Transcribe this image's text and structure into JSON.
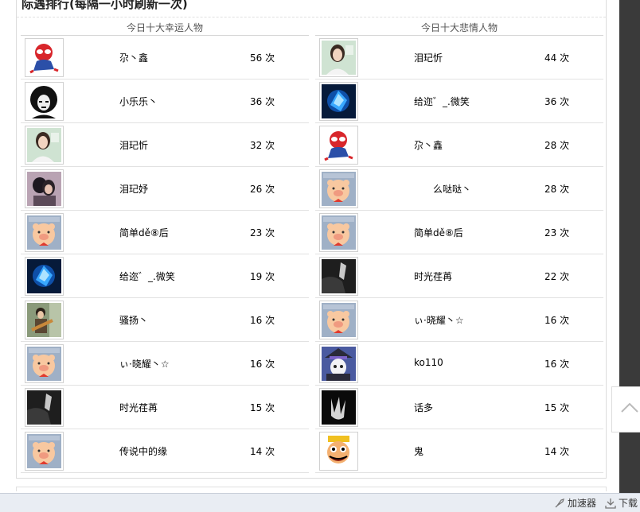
{
  "page": {
    "title": "际遇排行(每隔一小时刷新一次)"
  },
  "lucky": {
    "header": "今日十大幸运人物",
    "rows": [
      {
        "name": "尕丶鑫",
        "count": "56 次",
        "avatar": "spiderman-avatar-icon"
      },
      {
        "name": "小乐乐丶",
        "count": "36 次",
        "avatar": "afro-portrait-avatar-icon"
      },
      {
        "name": "泪玘忻",
        "count": "32 次",
        "avatar": "girl-photo-avatar-icon"
      },
      {
        "name": "泪玘妤",
        "count": "26 次",
        "avatar": "couple-photo-avatar-icon"
      },
      {
        "name": "简单dě⑧后",
        "count": "23 次",
        "avatar": "cartoon-pig-avatar-icon"
      },
      {
        "name": "给迩゛_.微笑",
        "count": "19 次",
        "avatar": "blue-crystal-avatar-icon"
      },
      {
        "name": "骚扬丶",
        "count": "16 次",
        "avatar": "guitar-boy-avatar-icon"
      },
      {
        "name": "ぃ·晓耀丶☆",
        "count": "16 次",
        "avatar": "cartoon-pig-avatar-icon"
      },
      {
        "name": "时光荏苒",
        "count": "15 次",
        "avatar": "dark-photo-avatar-icon"
      },
      {
        "name": "传说中的缘",
        "count": "14 次",
        "avatar": "cartoon-pig-avatar-icon"
      }
    ]
  },
  "sad": {
    "header": "今日十大悲情人物",
    "rows": [
      {
        "name": "泪玘忻",
        "count": "44 次",
        "avatar": "girl-photo-avatar-icon"
      },
      {
        "name": "给迩゛_.微笑",
        "count": "36 次",
        "avatar": "blue-crystal-avatar-icon"
      },
      {
        "name": "尕丶鑫",
        "count": "28 次",
        "avatar": "spiderman-avatar-icon"
      },
      {
        "name": "么哒哒丶",
        "count": "28 次",
        "avatar": "cartoon-pig-avatar-icon"
      },
      {
        "name": "简单dě⑧后",
        "count": "23 次",
        "avatar": "cartoon-pig-avatar-icon"
      },
      {
        "name": "时光荏苒",
        "count": "22 次",
        "avatar": "dark-photo-avatar-icon"
      },
      {
        "name": "ぃ·晓耀丶☆",
        "count": "16 次",
        "avatar": "cartoon-pig-avatar-icon"
      },
      {
        "name": "ko110",
        "count": "16 次",
        "avatar": "anime-hat-avatar-icon"
      },
      {
        "name": "话多",
        "count": "15 次",
        "avatar": "dark-hand-avatar-icon"
      },
      {
        "name": "鬼",
        "count": "14 次",
        "avatar": "cartoon-face-avatar-icon"
      }
    ]
  },
  "statusbar": {
    "accelerator": "加速器",
    "download": "下载"
  },
  "colors": {
    "scrollbar": "#3a3a3a",
    "statusbar": "#e9edf3",
    "border": "#dcdcdc"
  }
}
